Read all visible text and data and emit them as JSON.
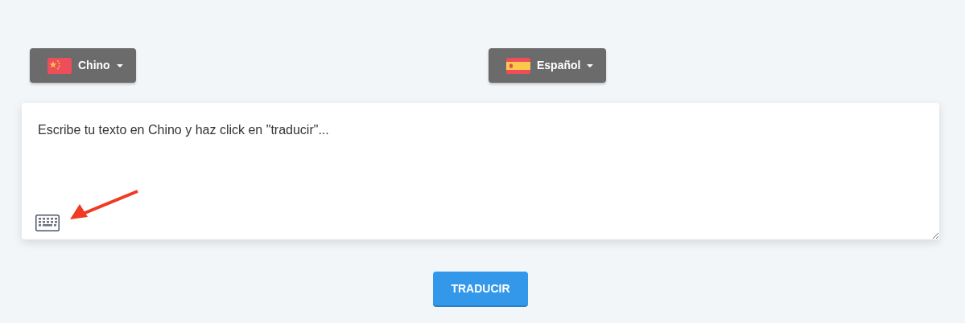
{
  "languages": [
    {
      "kind": "china",
      "label": "Chino"
    },
    {
      "kind": "spain",
      "label": "Español"
    }
  ],
  "input": {
    "placeholder": "Escribe tu texto en Chino y haz click en \"traducir\"..."
  },
  "submit": "TRADUCIR"
}
